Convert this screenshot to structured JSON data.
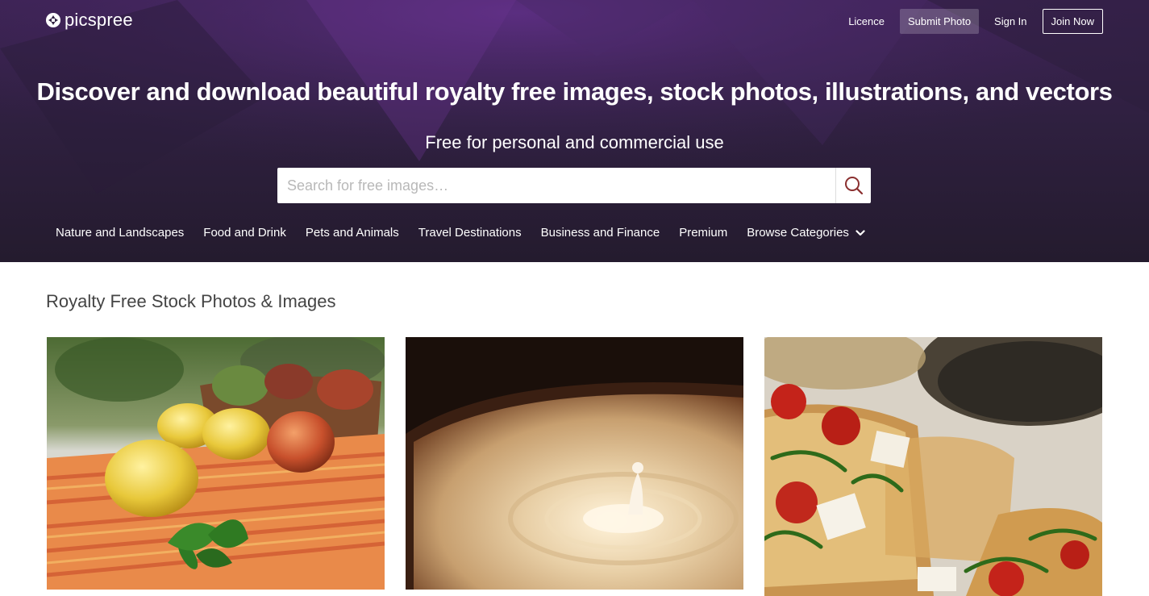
{
  "brand": {
    "name": "picspree"
  },
  "nav": {
    "licence": "Licence",
    "submit_photo": "Submit Photo",
    "sign_in": "Sign In",
    "join_now": "Join Now"
  },
  "hero": {
    "headline": "Discover and download beautiful royalty free images, stock photos, illustrations, and vectors",
    "subhead": "Free for personal and commercial use"
  },
  "search": {
    "placeholder": "Search for free images…",
    "value": ""
  },
  "categories": [
    "Nature and Landscapes",
    "Food and Drink",
    "Pets and Animals",
    "Travel Destinations",
    "Business and Finance",
    "Premium",
    "Browse Categories"
  ],
  "section": {
    "title": "Royalty Free Stock Photos & Images"
  },
  "photos": [
    {
      "subject": "lemons-peaches-mint-on-striped-cloth"
    },
    {
      "subject": "milk-drop-splash-in-coffee"
    },
    {
      "subject": "bruschetta-tomato-feta-arugula"
    }
  ],
  "colors": {
    "hero_purple": "#3d2355",
    "hero_dark": "#241b2e",
    "search_icon": "#8a2f2f"
  }
}
